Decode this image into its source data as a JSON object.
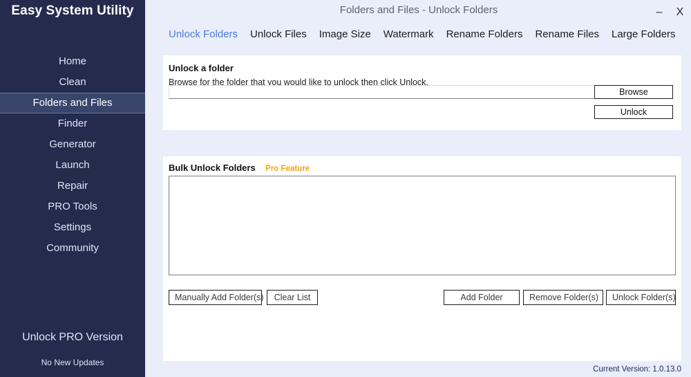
{
  "sidebar": {
    "brand": "Easy System Utility",
    "items": [
      {
        "label": "Home",
        "active": false
      },
      {
        "label": "Clean",
        "active": false
      },
      {
        "label": "Folders and Files",
        "active": true
      },
      {
        "label": "Finder",
        "active": false
      },
      {
        "label": "Generator",
        "active": false
      },
      {
        "label": "Launch",
        "active": false
      },
      {
        "label": "Repair",
        "active": false
      },
      {
        "label": "PRO Tools",
        "active": false
      },
      {
        "label": "Settings",
        "active": false
      },
      {
        "label": "Community",
        "active": false
      }
    ],
    "pro_version_label": "Unlock PRO Version",
    "update_status": "No New Updates"
  },
  "titlebar": {
    "title": "Folders and Files - Unlock Folders",
    "minimize_glyph": "–",
    "close_glyph": "X"
  },
  "tabs": [
    {
      "label": "Unlock Folders",
      "active": true
    },
    {
      "label": "Unlock Files",
      "active": false
    },
    {
      "label": "Image Size",
      "active": false
    },
    {
      "label": "Watermark",
      "active": false
    },
    {
      "label": "Rename Folders",
      "active": false
    },
    {
      "label": "Rename Files",
      "active": false
    },
    {
      "label": "Large Folders",
      "active": false
    }
  ],
  "single_panel": {
    "title": "Unlock a folder",
    "subtitle": "Browse for the folder that you would like to unlock then click Unlock.",
    "path_value": "",
    "path_placeholder": "",
    "browse_label": "Browse",
    "unlock_label": "Unlock"
  },
  "bulk_panel": {
    "title": "Bulk Unlock Folders",
    "pro_tag": "Pro Feature",
    "list_items": [],
    "manual_add_label": "Manually Add Folder(s)",
    "clear_list_label": "Clear List",
    "add_folder_label": "Add Folder",
    "remove_folders_label": "Remove Folder(s)",
    "unlock_folders_label": "Unlock Folder(s)"
  },
  "footer": {
    "version": "Current Version: 1.0.13.0"
  },
  "colors": {
    "sidebar_bg": "#242b4d",
    "sidebar_active_bg": "#3a456b",
    "app_bg": "#eaeefa",
    "panel_bg": "#ffffff",
    "accent_tab": "#4b7ce0",
    "pro_tag": "#f0a31a",
    "version_text": "#1d2b5a"
  }
}
